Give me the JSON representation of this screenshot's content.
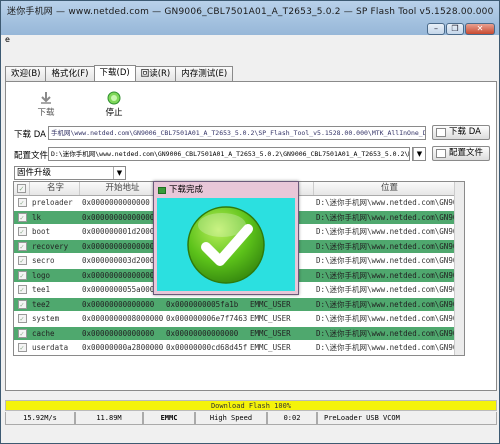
{
  "window": {
    "title": "迷你手机网 — www.netded.com — GN9006_CBL7501A01_A_T2653_5.0.2 — SP Flash Tool v5.1528.00.000",
    "btn_min": "–",
    "btn_max": "❐",
    "btn_close": "✕"
  },
  "menubar": {
    "item": "e"
  },
  "tabs": [
    "欢迎(B)",
    "格式化(F)",
    "下载(D)",
    "回读(R)",
    "内存测试(E)"
  ],
  "toolbar": {
    "download_label": "下载",
    "stop_label": "停止"
  },
  "download_agent": {
    "label": "下载 DA",
    "path": "手机网\\www.netded.com\\GN9006_CBL7501A01_A_T2653_5.0.2\\SP_Flash_Tool_v5.1528.00.000\\MTK_AllInOne_DA.bin",
    "button": "下载 DA"
  },
  "scatter": {
    "label": "配置文件",
    "path": "D:\\迷你手机网\\www.netded.com\\GN9006_CBL7501A01_A_T2653_5.0.2\\GN9006_CBL7501A01_A_T2653_5.0.2\\MT6752_",
    "button": "配置文件"
  },
  "mode": {
    "selected": "固件升级"
  },
  "table": {
    "headers": [
      "名字",
      "开始地址",
      "",
      "",
      "位置"
    ],
    "rows": [
      {
        "name": "preloader",
        "start": "0x0000000000000",
        "end": "",
        "region": "",
        "location": "D:\\迷你手机网\\www.netded.com\\GN9006_CBL7",
        "green": false
      },
      {
        "name": "lk",
        "start": "0x00000000000000",
        "end": "",
        "region": "",
        "location": "D:\\迷你手机网\\www.netded.com\\GN9006_CBL7",
        "green": true
      },
      {
        "name": "boot",
        "start": "0x000000001d2000",
        "end": "",
        "region": "",
        "location": "D:\\迷你手机网\\www.netded.com\\GN9006_CBL7",
        "green": false
      },
      {
        "name": "recovery",
        "start": "0x00000000000000",
        "end": "",
        "region": "",
        "location": "D:\\迷你手机网\\www.netded.com\\GN9006_CBL7",
        "green": true
      },
      {
        "name": "secro",
        "start": "0x000000003d2000",
        "end": "",
        "region": "",
        "location": "D:\\迷你手机网\\www.netded.com\\GN9006_CBL7",
        "green": false
      },
      {
        "name": "logo",
        "start": "0x00000000000000",
        "end": "",
        "region": "",
        "location": "D:\\迷你手机网\\www.netded.com\\GN9006_CBL7",
        "green": true
      },
      {
        "name": "tee1",
        "start": "0x0000000055a0000",
        "end": "",
        "region": "",
        "location": "D:\\迷你手机网\\www.netded.com\\GN9006_CBL7",
        "green": false
      },
      {
        "name": "tee2",
        "start": "0x00000000000000",
        "end": "0x0000000005fa1b",
        "region": "EMMC_USER",
        "location": "D:\\迷你手机网\\www.netded.com\\GN9006_CBL7",
        "green": true
      },
      {
        "name": "system",
        "start": "0x0000000008000000",
        "end": "0x000000006e7f7463",
        "region": "EMMC_USER",
        "location": "D:\\迷你手机网\\www.netded.com\\GN9006_CBL7",
        "green": false
      },
      {
        "name": "cache",
        "start": "0x00000000000000",
        "end": "0x00000000000000",
        "region": "EMMC_USER",
        "location": "D:\\迷你手机网\\www.netded.com\\GN9006_CBL7",
        "green": true
      },
      {
        "name": "userdata",
        "start": "0x00000000a2800000",
        "end": "0x00000000cd68d45f",
        "region": "EMMC_USER",
        "location": "D:\\迷你手机网\\www.netded.com\\GN9006_CBL7",
        "green": false
      }
    ]
  },
  "dialog": {
    "title": "下载完成"
  },
  "progress": {
    "text": "Download Flash 100%",
    "value": 1.0
  },
  "statusbar": [
    "15.92M/s",
    "11.89M",
    "EMMC",
    "High Speed",
    "0:02",
    "PreLoader USB VCOM"
  ],
  "colors": {
    "progress_fill": "#f5f30a",
    "dialog_body": "#2be0e0",
    "row_green": "#4fa86e",
    "check_green": "#5cc21a"
  }
}
